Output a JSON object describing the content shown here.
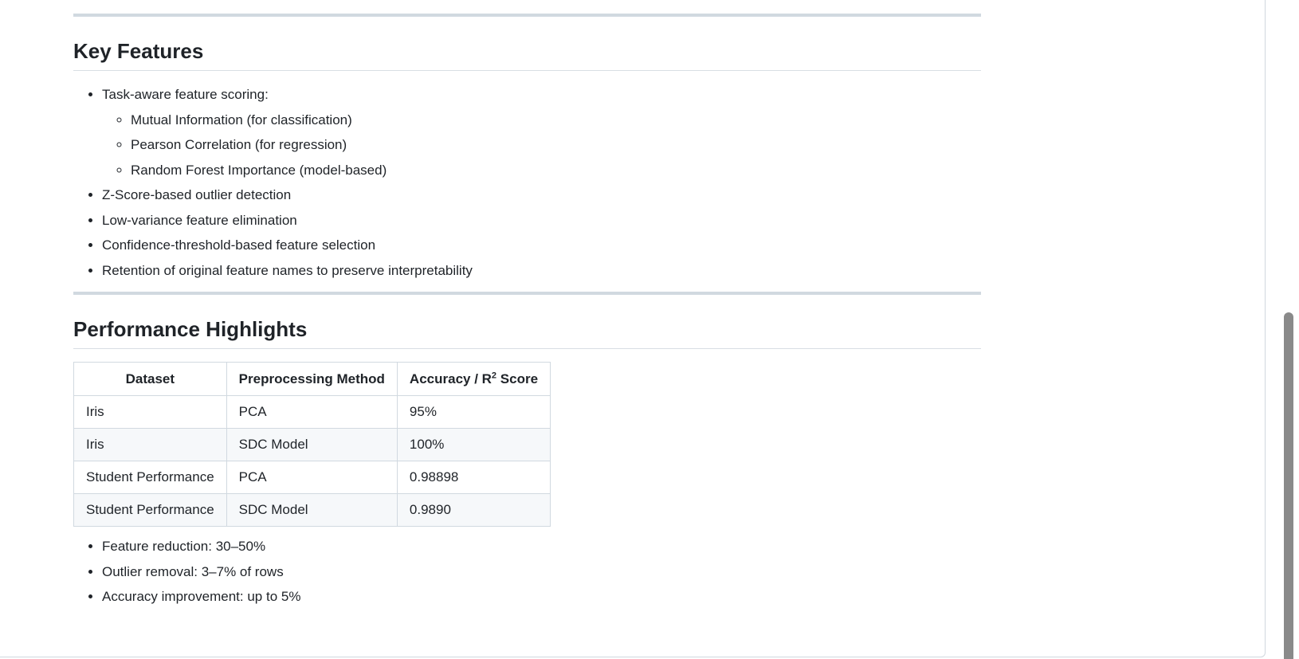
{
  "key_features": {
    "heading": "Key Features",
    "items": [
      {
        "label": "Task-aware feature scoring:",
        "sub": [
          "Mutual Information (for classification)",
          "Pearson Correlation (for regression)",
          "Random Forest Importance (model-based)"
        ]
      },
      {
        "label": "Z-Score-based outlier detection"
      },
      {
        "label": "Low-variance feature elimination"
      },
      {
        "label": "Confidence-threshold-based feature selection"
      },
      {
        "label": "Retention of original feature names to preserve interpretability"
      }
    ]
  },
  "performance": {
    "heading": "Performance Highlights",
    "table": {
      "headers": [
        "Dataset",
        "Preprocessing Method",
        "Accuracy / R",
        "2",
        " Score"
      ],
      "rows": [
        [
          "Iris",
          "PCA",
          "95%"
        ],
        [
          "Iris",
          "SDC Model",
          "100%"
        ],
        [
          "Student Performance",
          "PCA",
          "0.98898"
        ],
        [
          "Student Performance",
          "SDC Model",
          "0.9890"
        ]
      ]
    },
    "summary": [
      "Feature reduction: 30–50%",
      "Outlier removal: 3–7% of rows",
      "Accuracy improvement: up to 5%"
    ]
  }
}
